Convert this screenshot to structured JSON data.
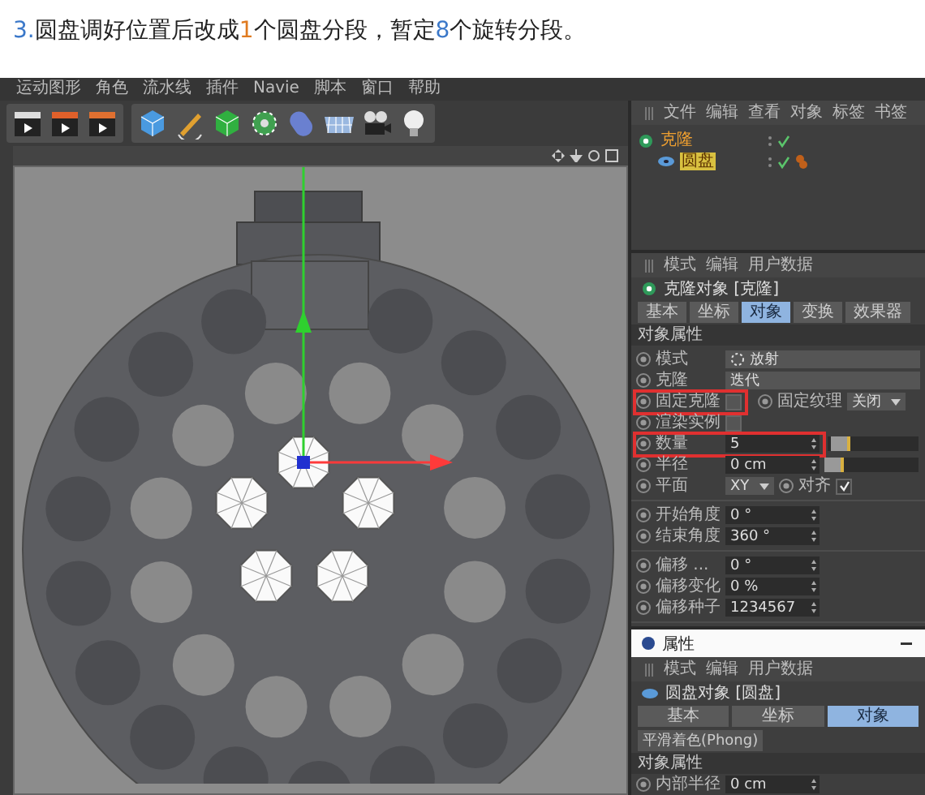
{
  "caption": [
    {
      "text": "3.",
      "color": "#3b78c9"
    },
    {
      "text": "圆盘调好位置后改成"
    },
    {
      "text": "1",
      "color": "#e07b20"
    },
    {
      "text": "个圆盘分段，暂定"
    },
    {
      "text": "8",
      "color": "#3b78c9"
    },
    {
      "text": "个旋转分段。"
    }
  ],
  "menu": [
    "运动图形",
    "角色",
    "流水线",
    "插件",
    "Navie",
    "脚本",
    "窗口",
    "帮助"
  ],
  "object_manager": {
    "menu": [
      "文件",
      "编辑",
      "查看",
      "对象",
      "标签",
      "书签"
    ],
    "objects": [
      {
        "name": "克隆",
        "selected": true,
        "active": false,
        "has_tag": false,
        "children": [
          {
            "name": "圆盘",
            "selected": true,
            "active": true,
            "has_tag": true
          }
        ]
      }
    ]
  },
  "attributes": {
    "menu": [
      "模式",
      "编辑",
      "用户数据"
    ],
    "title": "克隆对象 [克隆]",
    "tabs": [
      {
        "label": "基本",
        "selected": false
      },
      {
        "label": "坐标",
        "selected": false
      },
      {
        "label": "对象",
        "selected": true
      },
      {
        "label": "变换",
        "selected": false
      },
      {
        "label": "效果器",
        "selected": false
      }
    ],
    "section": "对象属性",
    "groups": [
      [
        {
          "kind": "select_icon",
          "label": "模式",
          "value": "放射",
          "highlighted": false
        },
        {
          "kind": "select",
          "label": "克隆",
          "value": "迭代",
          "highlighted": false
        },
        {
          "kind": "checkbox_select",
          "label": "固定克隆",
          "checked": false,
          "label_2": "固定纹理",
          "value": "关闭",
          "highlighted": true
        },
        {
          "kind": "checkbox",
          "label": "渲染实例",
          "checked": false,
          "highlighted": false
        },
        {
          "kind": "slider",
          "label": "数量",
          "value": "5",
          "level": 0.04,
          "highlighted": true
        },
        {
          "kind": "slider",
          "label": "半径",
          "value": "0 cm",
          "level": 0,
          "highlighted": false
        },
        {
          "kind": "plane",
          "label": "平面",
          "value": "XY",
          "label_2": "对齐",
          "checked": true,
          "highlighted": false
        }
      ],
      [
        {
          "kind": "number",
          "label": "开始角度",
          "value": "0 °",
          "highlighted": false
        },
        {
          "kind": "number",
          "label": "结束角度",
          "value": "360 °",
          "highlighted": false
        }
      ],
      [
        {
          "kind": "number",
          "label": "偏移 ...",
          "value": "0 °",
          "highlighted": false
        },
        {
          "kind": "number",
          "label": "偏移变化",
          "value": "0 %",
          "highlighted": false
        },
        {
          "kind": "number",
          "label": "偏移种子",
          "value": "1234567",
          "highlighted": false
        }
      ]
    ]
  },
  "properties_window": {
    "title": "属性",
    "menu": [
      "模式",
      "编辑",
      "用户数据"
    ],
    "object_title": "圆盘对象 [圆盘]",
    "tabs": [
      {
        "label": "基本",
        "selected": false
      },
      {
        "label": "坐标",
        "selected": false
      },
      {
        "label": "对象",
        "selected": true
      }
    ],
    "button": "平滑着色(Phong)",
    "section": "对象属性",
    "rows": [
      {
        "label": "内部半径",
        "value": "0 cm"
      }
    ]
  }
}
